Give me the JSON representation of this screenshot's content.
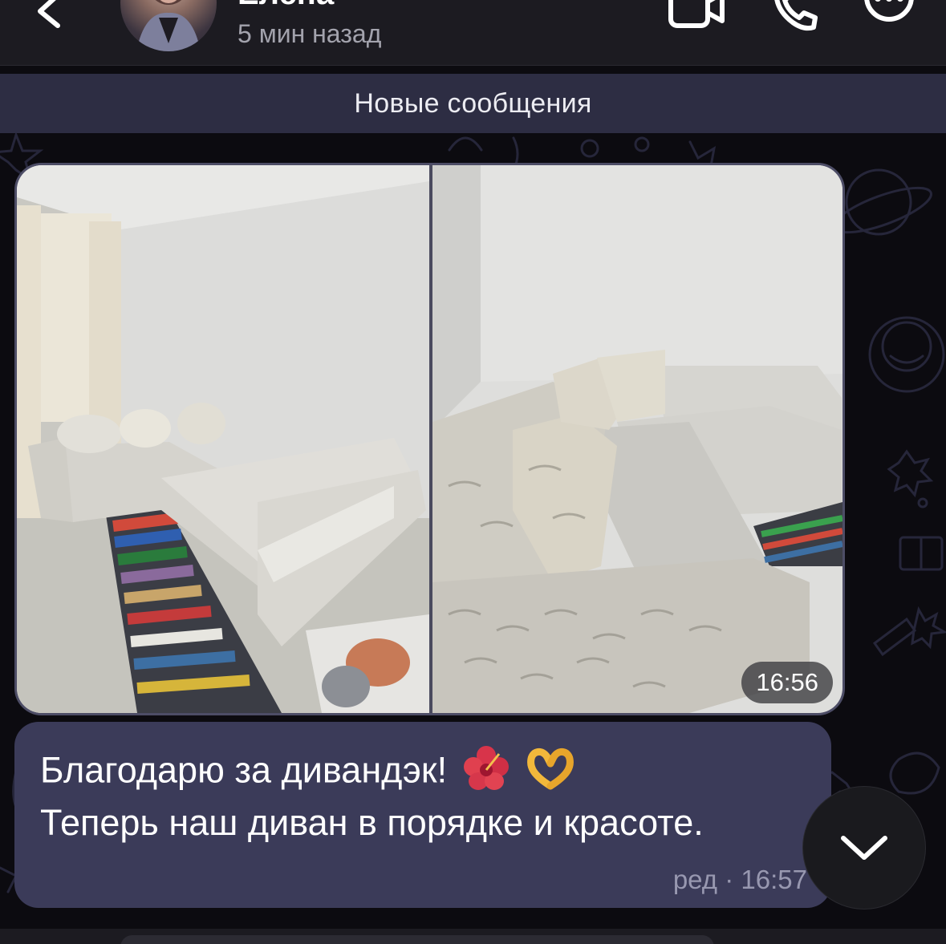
{
  "header": {
    "contact_name": "Елена",
    "status": "5 мин назад",
    "icons": [
      "back-icon",
      "video-call-icon",
      "phone-icon",
      "more-icon"
    ]
  },
  "banner": {
    "label": "Новые сообщения"
  },
  "album": {
    "photos": [
      "sofa-photo-1",
      "sofa-photo-2"
    ],
    "time": "16:56"
  },
  "message": {
    "line1": "Благодарю за дивандэк!",
    "line2": "Теперь наш диван в порядке и  красоте.",
    "emojis": [
      "hibiscus-emoji",
      "heart-hands-emoji"
    ],
    "edited_label": "ред",
    "separator": "·",
    "time": "16:57"
  },
  "colors": {
    "background": "#0c0b10",
    "header": "#1c1b21",
    "banner": "#2d2d43",
    "bubble": "#3b3b59",
    "meta_text": "#9898b0"
  }
}
